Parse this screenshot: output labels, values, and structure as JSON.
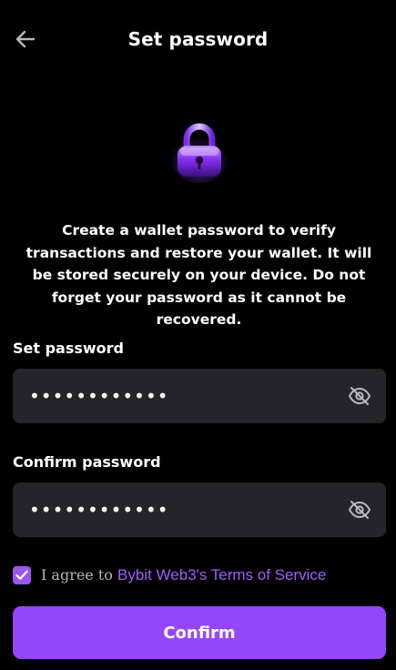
{
  "header": {
    "title": "Set password",
    "back_icon": "arrow-left-icon"
  },
  "hero": {
    "icon": "lock-icon",
    "description": "Create a wallet password to verify transactions and restore your wallet. It will be stored securely on your device. Do not forget your password as it cannot be recovered."
  },
  "form": {
    "set_password": {
      "label": "Set password",
      "value": "••••••••••••",
      "toggle_icon": "eye-off-icon"
    },
    "confirm_password": {
      "label": "Confirm password",
      "value": "••••••••••••",
      "toggle_icon": "eye-off-icon"
    },
    "agreement": {
      "checked": true,
      "prefix": "I agree to ",
      "link": "Bybit Web3's Terms of Service"
    },
    "confirm_label": "Confirm"
  },
  "colors": {
    "background": "#000000",
    "field_bg": "#22252a",
    "accent": "#9546fb",
    "link": "#a45cff",
    "muted_text": "#b6b6bb"
  }
}
